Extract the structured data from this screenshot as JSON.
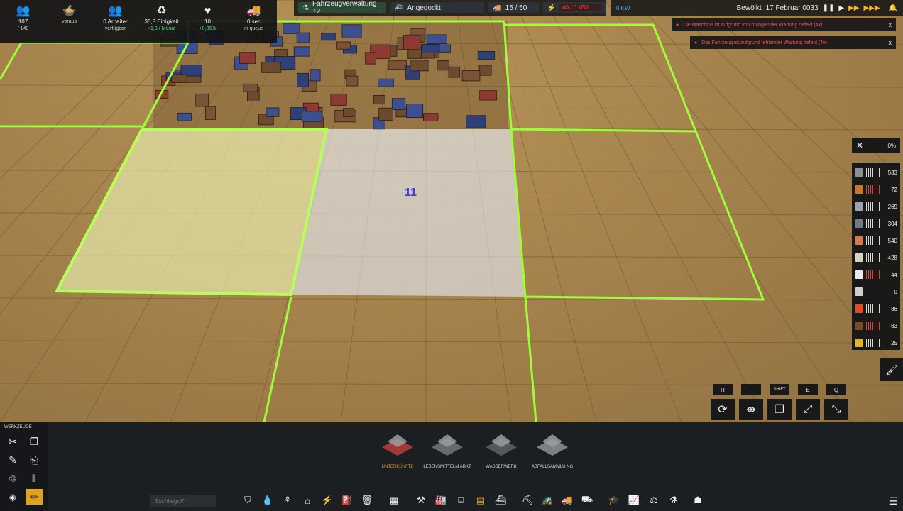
{
  "top_stats": [
    {
      "icon": "population-icon",
      "glyph": "👥",
      "value": "107",
      "sub": "/ 140",
      "extra": ""
    },
    {
      "icon": "food-icon",
      "glyph": "🍲",
      "value": "",
      "sub": "voraus",
      "extra": ""
    },
    {
      "icon": "workers-icon",
      "glyph": "👥",
      "value": "0 Arbeiter",
      "sub": "verfügbar",
      "extra": ""
    },
    {
      "icon": "unity-icon",
      "glyph": "♻",
      "value": "35,8 Einigkeit",
      "sub": "",
      "extra": "+1,3 / Monat"
    },
    {
      "icon": "health-icon",
      "glyph": "♥",
      "value": "10",
      "sub": "",
      "extra": "+0,05%"
    },
    {
      "icon": "vehicle-queue-icon",
      "glyph": "🚚",
      "value": "0 sec",
      "sub": "in queue",
      "extra": ""
    }
  ],
  "topbar_mid": {
    "research_label": "Fahrzeugverwaltung +2",
    "dock_label": "Angedockt",
    "vehicles": "15 / 50",
    "energy_value": "40 / 0 MW"
  },
  "topbar_right": {
    "power_value": "0 KW",
    "weather": "Bewölkt",
    "date": "17 Februar 0033"
  },
  "alerts": [
    "Die Maschine ist aufgrund von mangelnder Wartung defekt (4x)",
    "Das Fahrzeug ist aufgrund fehlender Wartung defekt (4x)"
  ],
  "alert_close": "x",
  "progress": "0%",
  "resources": [
    {
      "icon": "stone-icon",
      "color": "#8a8f94",
      "value": "533",
      "bars": "white"
    },
    {
      "icon": "wood-icon",
      "color": "#c9772c",
      "value": "72",
      "bars": "red"
    },
    {
      "icon": "iron-icon",
      "color": "#9aa3aa",
      "value": "269",
      "bars": "white"
    },
    {
      "icon": "steel-icon",
      "color": "#6e7a84",
      "value": "304",
      "bars": "white"
    },
    {
      "icon": "bricks-icon",
      "color": "#d7784a",
      "value": "540",
      "bars": "white"
    },
    {
      "icon": "food-crate-icon",
      "color": "#d8d0c0",
      "value": "428",
      "bars": "white"
    },
    {
      "icon": "water-icon",
      "color": "#e8e8e8",
      "value": "44",
      "bars": "red"
    },
    {
      "icon": "tools-icon",
      "color": "#cfcfcf",
      "value": "0",
      "bars": "empty"
    },
    {
      "icon": "fuel-icon",
      "color": "#e24a2a",
      "value": "86",
      "bars": "white"
    },
    {
      "icon": "coal-icon",
      "color": "#7a4a2a",
      "value": "83",
      "bars": "red"
    },
    {
      "icon": "gold-icon",
      "color": "#e0b030",
      "value": "25",
      "bars": "white"
    }
  ],
  "keys": [
    "R",
    "F",
    "SHIFT",
    "E",
    "Q"
  ],
  "tools_title": "WERKZEUGE",
  "buildings": [
    {
      "label": "UNTERKÜNFTE",
      "active": true
    },
    {
      "label": "LEBENSMITTELM ARKT",
      "active": false
    },
    {
      "label": "WASSERWERK",
      "active": false
    },
    {
      "label": "ABFALLSAMMLU NG",
      "active": false
    }
  ],
  "search_placeholder": "Suchbegriff",
  "worker_badge": "11"
}
